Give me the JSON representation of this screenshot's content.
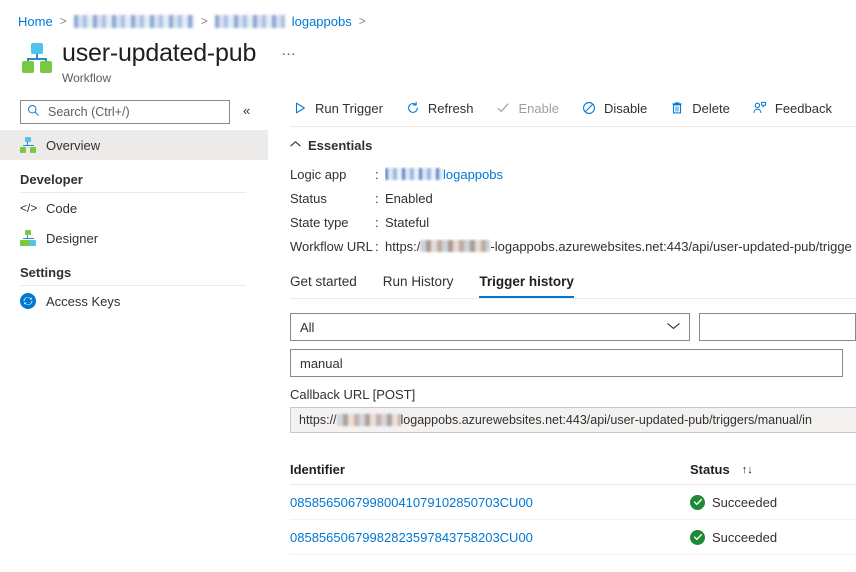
{
  "breadcrumb": {
    "home": "Home",
    "redacted_1": "",
    "redacted_2": "",
    "logapp": "logappobs",
    "separator": ">"
  },
  "header": {
    "title": "user-updated-pub",
    "subtitle": "Workflow",
    "more_menu": "…",
    "icon": "workflow-icon"
  },
  "sidebar": {
    "search_placeholder": "Search (Ctrl+/)",
    "search_value": "",
    "search_icon": "search-icon",
    "collapse_icon": "«",
    "items": [
      {
        "label": "Overview",
        "icon": "workflow-icon",
        "selected": true
      }
    ],
    "sections": [
      {
        "title": "Developer",
        "items": [
          {
            "label": "Code",
            "icon": "code-icon"
          },
          {
            "label": "Designer",
            "icon": "designer-icon"
          }
        ]
      },
      {
        "title": "Settings",
        "items": [
          {
            "label": "Access Keys",
            "icon": "access-keys-icon"
          }
        ]
      }
    ]
  },
  "toolbar": {
    "buttons": [
      {
        "label": "Run Trigger",
        "icon": "play-icon",
        "disabled": false
      },
      {
        "label": "Refresh",
        "icon": "refresh-icon",
        "disabled": false
      },
      {
        "label": "Enable",
        "icon": "checkmark-icon",
        "disabled": true
      },
      {
        "label": "Disable",
        "icon": "block-icon",
        "disabled": false
      },
      {
        "label": "Delete",
        "icon": "trash-icon",
        "disabled": false
      },
      {
        "label": "Feedback",
        "icon": "person-feedback-icon",
        "disabled": false
      }
    ]
  },
  "essentials": {
    "title": "Essentials",
    "chevron": "⌃",
    "rows": [
      {
        "key": "Logic app",
        "colon": ":",
        "value": "logappobs",
        "redacted_prefix": true,
        "link": true
      },
      {
        "key": "Status",
        "colon": ":",
        "value": "Enabled",
        "link": false
      },
      {
        "key": "State type",
        "colon": ":",
        "value": "Stateful",
        "link": false
      },
      {
        "key": "Workflow URL",
        "colon": ":",
        "value_pre": "https:/",
        "value_post": "-logappobs.azurewebsites.net:443/api/user-updated-pub/trigge",
        "redacted_prefix": true,
        "link": false
      }
    ]
  },
  "tabs": [
    {
      "label": "Get started",
      "active": false
    },
    {
      "label": "Run History",
      "active": false
    },
    {
      "label": "Trigger history",
      "active": true
    }
  ],
  "filters": {
    "status_select": "All",
    "status_chevron": "⌄",
    "second_field_value": "",
    "trigger_name": "manual",
    "callback_label": "Callback URL [POST]",
    "callback_url_pre": "https://",
    "callback_url_post": "logappobs.azurewebsites.net:443/api/user-updated-pub/triggers/manual/in"
  },
  "table": {
    "columns": [
      {
        "label": "Identifier",
        "sortable": false
      },
      {
        "label": "Status",
        "sortable": true,
        "sort_glyph": "↑↓"
      }
    ],
    "rows": [
      {
        "identifier": "08585650679980041079102850703CU00",
        "status": "Succeeded",
        "status_icon": "success-check-icon"
      },
      {
        "identifier": "08585650679982823597843758203CU00",
        "status": "Succeeded",
        "status_icon": "success-check-icon"
      }
    ]
  },
  "colors": {
    "accent": "#0078d4",
    "success": "#1d8a34",
    "text": "#323130",
    "selected_bg": "#edebe9",
    "border": "#8a8886",
    "node_blue": "#50c2f0",
    "node_green": "#7ac943"
  }
}
